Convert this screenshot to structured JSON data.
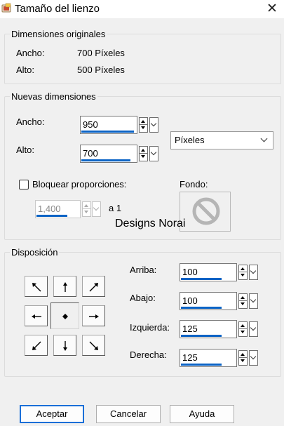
{
  "window": {
    "title": "Tamaño del lienzo",
    "close_glyph": "✕"
  },
  "original": {
    "legend": "Dimensiones originales",
    "width_label": "Ancho:",
    "width_value": "700 Píxeles",
    "height_label": "Alto:",
    "height_value": "500 Píxeles"
  },
  "new_dims": {
    "legend": "Nuevas dimensiones",
    "width_label": "Ancho:",
    "width_value": "950",
    "height_label": "Alto:",
    "height_value": "700",
    "unit": "Píxeles",
    "lock_label": "Bloquear proporciones:",
    "lock_checked": false,
    "ratio_value": "1,400",
    "ratio_suffix": "a 1",
    "background_label": "Fondo:"
  },
  "watermark": "Designs Norai",
  "layout": {
    "legend": "Disposición",
    "anchor_icons": [
      "arrow-up-left-icon",
      "arrow-up-icon",
      "arrow-up-right-icon",
      "arrow-left-icon",
      "center-dot-icon",
      "arrow-right-icon",
      "arrow-down-left-icon",
      "arrow-down-icon",
      "arrow-down-right-icon"
    ],
    "selected_anchor": "center",
    "top_label": "Arriba:",
    "top_value": "100",
    "bottom_label": "Abajo:",
    "bottom_value": "100",
    "left_label": "Izquierda:",
    "left_value": "125",
    "right_label": "Derecha:",
    "right_value": "125"
  },
  "buttons": {
    "ok": "Aceptar",
    "cancel": "Cancelar",
    "help": "Ayuda"
  },
  "colors": {
    "accent": "#0b63c5",
    "default_button_border": "#1a6fd8",
    "dialog_bg": "#f0f0f0"
  }
}
